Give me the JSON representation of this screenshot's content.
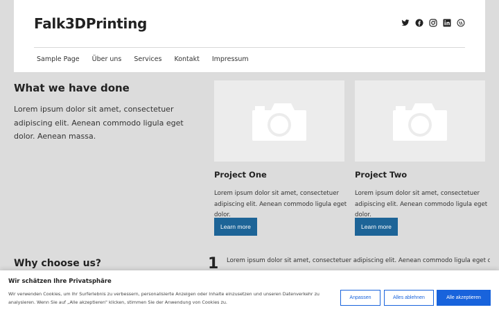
{
  "site": {
    "title": "Falk3DPrinting"
  },
  "social": [
    {
      "icon": "twitter-icon"
    },
    {
      "icon": "facebook-icon"
    },
    {
      "icon": "instagram-icon"
    },
    {
      "icon": "linkedin-icon"
    },
    {
      "icon": "wordpress-icon"
    }
  ],
  "nav": {
    "items": [
      {
        "label": "Sample Page"
      },
      {
        "label": "Über uns"
      },
      {
        "label": "Services"
      },
      {
        "label": "Kontakt"
      },
      {
        "label": "Impressum"
      }
    ]
  },
  "main": {
    "heading": "What we have done",
    "lead": "Lorem ipsum dolor sit amet, consectetuer adipiscing elit. Aenean commodo ligula eget dolor. Aenean massa.",
    "projects": [
      {
        "title": "Project One",
        "text": "Lorem ipsum dolor sit amet, consectetuer adipiscing elit. Aenean commodo ligula eget dolor.",
        "button": "Learn more"
      },
      {
        "title": "Project Two",
        "text": "Lorem ipsum dolor sit amet, consectetuer adipiscing elit. Aenean commodo ligula eget dolor.",
        "button": "Learn more"
      }
    ]
  },
  "why": {
    "heading": "Why choose us?",
    "number": "1",
    "text": "Lorem ipsum dolor sit amet, consectetuer adipiscing elit. Aenean commodo ligula eget dolor. Aenean"
  },
  "cookie": {
    "title": "Wir schätzen Ihre Privatsphäre",
    "text": "Wir verwenden Cookies, um Ihr Surferlebnis zu verbessern, personalisierte Anzeigen oder Inhalte einzusetzen und unseren Datenverkehr zu analysieren. Wenn Sie auf „Alle akzeptieren\" klicken, stimmen Sie der Anwendung von Cookies zu.",
    "customize": "Anpassen",
    "reject": "Alles ablehnen",
    "accept": "Alle akzeptieren"
  },
  "colors": {
    "button": "#1d6497",
    "cookie_accent": "#1863dc",
    "background": "#dcdcdc"
  }
}
